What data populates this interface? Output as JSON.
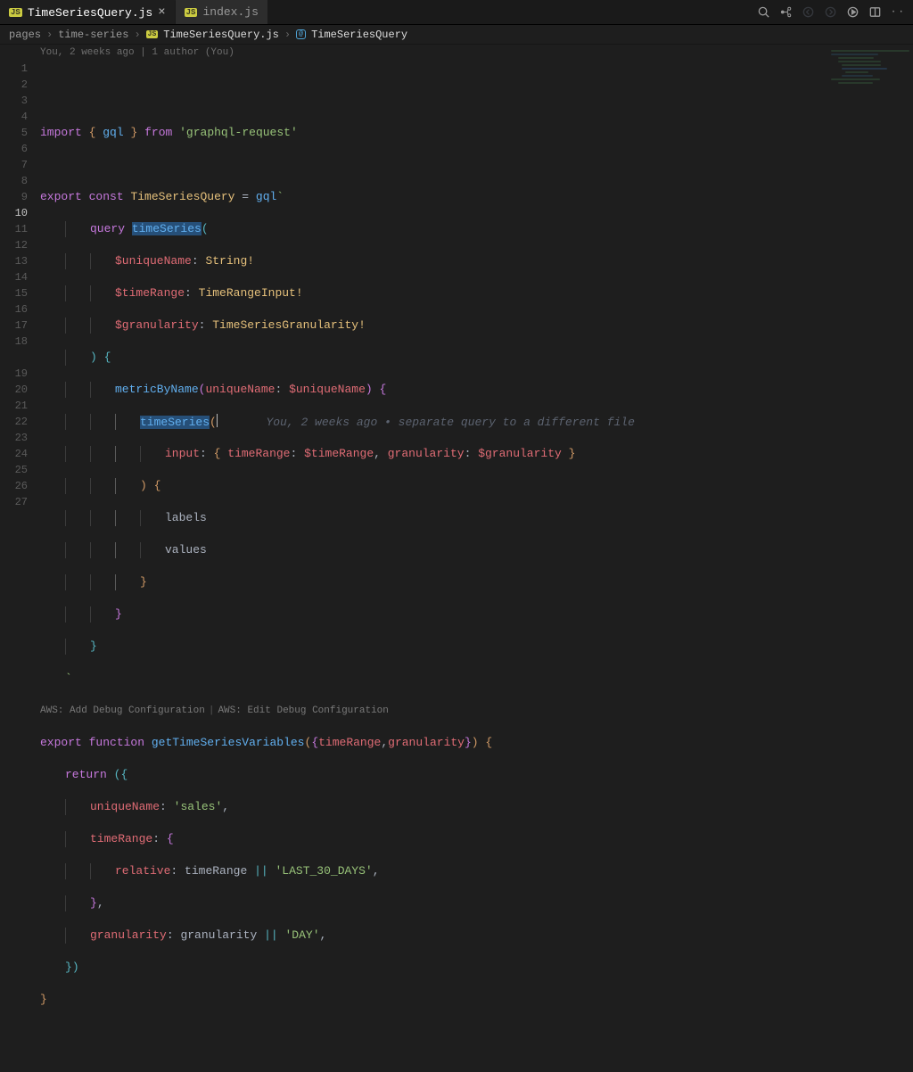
{
  "tabs": [
    {
      "icon": "JS",
      "label": "TimeSeriesQuery.js",
      "active": true
    },
    {
      "icon": "JS",
      "label": "index.js",
      "active": false
    }
  ],
  "breadcrumbs": {
    "items": [
      "pages",
      "time-series",
      "TimeSeriesQuery.js",
      "TimeSeriesQuery"
    ],
    "fileIcon": "JS",
    "symbolIcon": "[@]"
  },
  "blame_top": "You, 2 weeks ago | 1 author (You)",
  "inline_blame_line10": "You, 2 weeks ago • separate query to a different file",
  "codelens": {
    "left": "AWS: Add Debug Configuration",
    "right": "AWS: Edit Debug Configuration"
  },
  "tokens": {
    "import": "import",
    "export": "export",
    "const": "const",
    "function": "function",
    "return": "return",
    "from": "from",
    "gql": "gql",
    "graphql_request": "'graphql-request'",
    "TimeSeriesQuery": "TimeSeriesQuery",
    "eq": " = ",
    "backtick": "`",
    "query": "query",
    "timeSeries": "timeSeries",
    "uniqueNameArg": "$uniqueName",
    "timeRangeArg": "$timeRange",
    "granularityArg": "$granularity",
    "String": "String!",
    "TimeRangeInput": "TimeRangeInput!",
    "TimeSeriesGranularity": "TimeSeriesGranularity!",
    "metricByName": "metricByName",
    "uniqueName": "uniqueName",
    "input": "input",
    "timeRangeKey": "timeRange",
    "granularityKey": "granularity",
    "labels": "labels",
    "values": "values",
    "getTimeSeriesVariables": "getTimeSeriesVariables",
    "sales": "'sales'",
    "relative": "relative",
    "LAST_30_DAYS": "'LAST_30_DAYS'",
    "DAY": "'DAY'",
    "or": "||",
    "lbrace": "{",
    "rbrace": "}",
    "lparen": "(",
    "rparen": ")",
    "colon": ":",
    "comma": ","
  },
  "line_numbers": [
    "1",
    "2",
    "3",
    "4",
    "5",
    "6",
    "7",
    "8",
    "9",
    "10",
    "11",
    "12",
    "13",
    "14",
    "15",
    "16",
    "17",
    "18",
    "19",
    "20",
    "21",
    "22",
    "23",
    "24",
    "25",
    "26",
    "27"
  ],
  "active_line": 10
}
